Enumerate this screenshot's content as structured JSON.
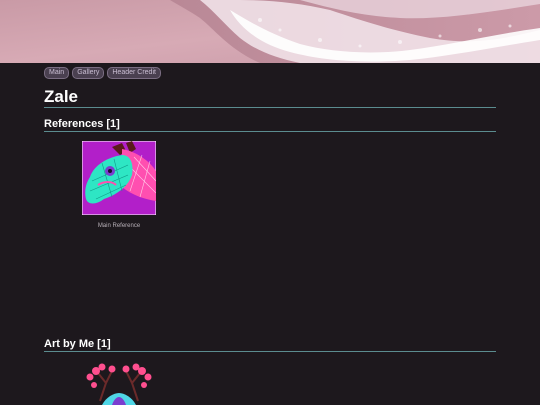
{
  "nav": {
    "items": [
      "Main",
      "Gallery",
      "Header Credit"
    ]
  },
  "page": {
    "title": "Zale"
  },
  "sections": {
    "references": {
      "title": "References [1]",
      "items": [
        {
          "caption": "Main Reference"
        }
      ]
    },
    "art": {
      "title": "Art by Me [1]"
    }
  },
  "colors": {
    "background": "#1d181d",
    "rule": "#5b8c8f",
    "nav_pill": "#4a4050"
  }
}
